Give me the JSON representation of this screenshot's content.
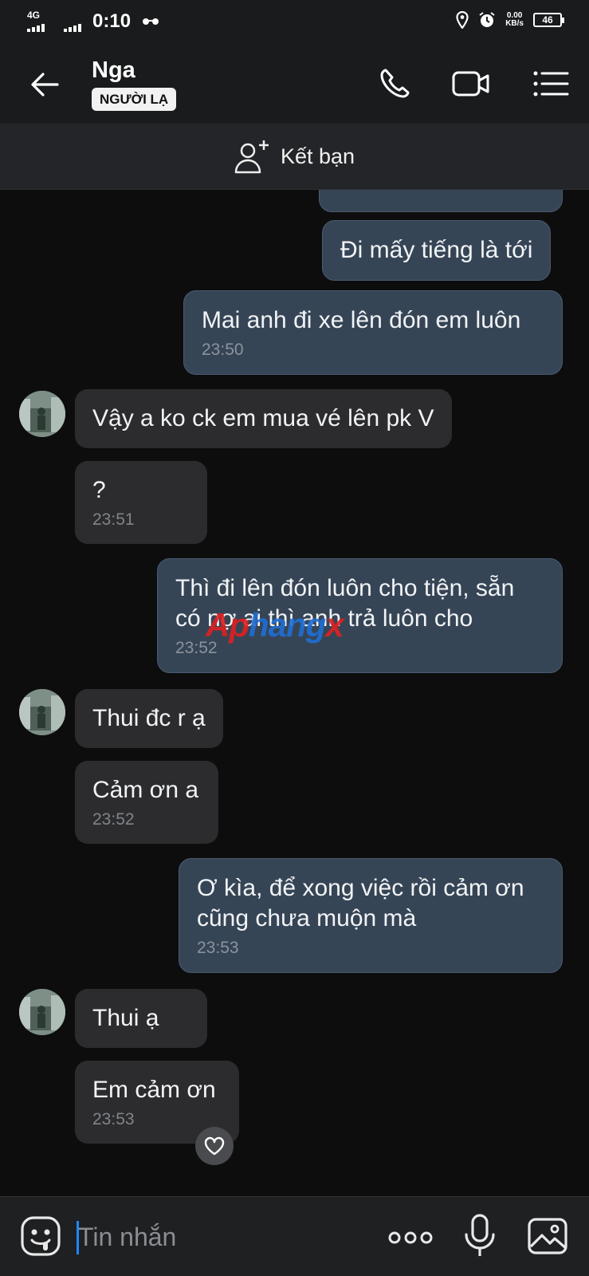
{
  "status_bar": {
    "network": "4G",
    "time": "0:10",
    "speed_value": "0.00",
    "speed_unit": "KB/s",
    "battery": "46"
  },
  "header": {
    "contact_name": "Nga",
    "badge": "NGƯỜI LẠ"
  },
  "add_friend": {
    "label": "Kết bạn"
  },
  "messages": {
    "m1": {
      "text": "Đi mấy tiếng là tới"
    },
    "m2": {
      "text": "Mai anh đi xe lên đón em luôn",
      "time": "23:50"
    },
    "m3": {
      "text": "Vậy a ko ck em mua vé lên pk V"
    },
    "m4": {
      "text": "?",
      "time": "23:51"
    },
    "m5": {
      "text": "Thì đi lên đón luôn cho tiện, sẵn có nợ ai thì anh trả luôn cho",
      "time": "23:52"
    },
    "m6": {
      "text": "Thui đc r ạ"
    },
    "m7": {
      "text": "Cảm ơn a",
      "time": "23:52"
    },
    "m8": {
      "text": "Ơ kìa, để xong việc rồi cảm ơn cũng chưa muộn mà",
      "time": "23:53"
    },
    "m9": {
      "text": "Thui ạ"
    },
    "m10": {
      "text": "Em cảm ơn",
      "time": "23:53"
    }
  },
  "watermark": {
    "part_a": "Ap",
    "part_b": "hang",
    "part_c": "x"
  },
  "input": {
    "placeholder": "Tin nhắn"
  },
  "colors": {
    "background": "#0d0d0e",
    "outgoing_bubble": "#364556",
    "incoming_bubble": "#2c2c2e",
    "caret": "#1e88ff"
  }
}
